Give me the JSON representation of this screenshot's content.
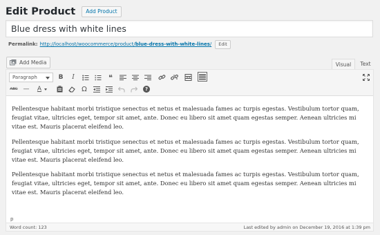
{
  "header": {
    "title": "Edit Product",
    "add_button": "Add Product"
  },
  "title_field": {
    "value": "Blue dress with white lines"
  },
  "permalink": {
    "label": "Permalink:",
    "base": "http://localhost/woocommerce/product/",
    "slug": "blue-dress-with-white-lines",
    "suffix": "/",
    "edit_label": "Edit"
  },
  "media": {
    "add_label": "Add Media"
  },
  "tabs": {
    "visual": "Visual",
    "text": "Text"
  },
  "toolbar": {
    "format_value": "Paragraph",
    "bold": "B",
    "italic": "I",
    "blockquote": "❝",
    "strike": "ABC",
    "hr": "—",
    "textcolor": "A",
    "omega": "Ω",
    "help": "?"
  },
  "content": {
    "paragraphs": [
      "Pellentesque habitant morbi tristique senectus et netus et malesuada fames ac turpis egestas. Vestibulum tortor quam, feugiat vitae, ultricies eget, tempor sit amet, ante. Donec eu libero sit amet quam egestas semper. Aenean ultricies mi vitae est. Mauris placerat eleifend leo.",
      "Pellentesque habitant morbi tristique senectus et netus et malesuada fames ac turpis egestas. Vestibulum tortor quam, feugiat vitae, ultricies eget, tempor sit amet, ante. Donec eu libero sit amet quam egestas semper. Aenean ultricies mi vitae est. Mauris placerat eleifend leo.",
      "Pellentesque habitant morbi tristique senectus et netus et malesuada fames ac turpis egestas. Vestibulum tortor quam, feugiat vitae, ultricies eget, tempor sit amet, ante. Donec eu libero sit amet quam egestas semper. Aenean ultricies mi vitae est. Mauris placerat eleifend leo."
    ],
    "path": "p"
  },
  "status": {
    "word_count": "Word count: 123",
    "last_edited": "Last edited by admin on December 19, 2016 at 1:39 pm"
  },
  "colors": {
    "link": "#0073aa",
    "border": "#dddddd",
    "background": "#f1f1f1"
  }
}
